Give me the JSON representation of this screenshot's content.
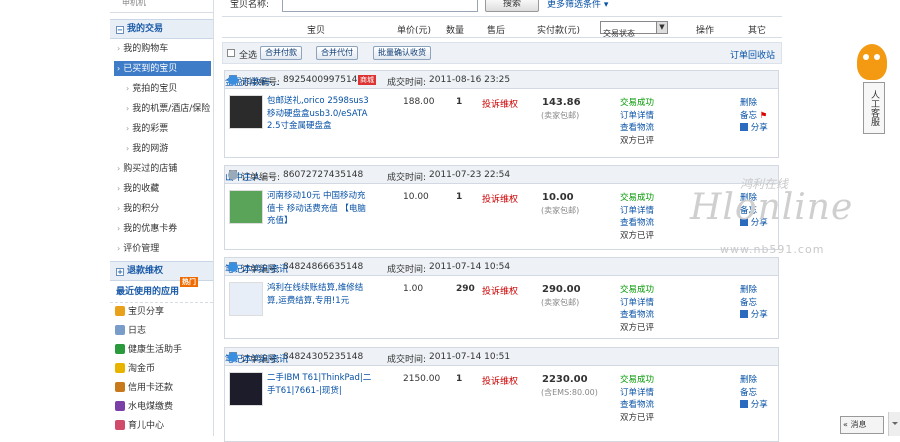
{
  "sidebar": {
    "top_label": "申机机",
    "trade_header": "我的交易",
    "items": [
      {
        "label": "我的购物车"
      },
      {
        "label": "已买到的宝贝",
        "active": true
      },
      {
        "label": "竞拍的宝贝",
        "sub": true
      },
      {
        "label": "我的机票/酒店/保险",
        "sub": true
      },
      {
        "label": "我的彩票",
        "sub": true
      },
      {
        "label": "我的网游",
        "sub": true
      },
      {
        "label": "购买过的店铺"
      },
      {
        "label": "我的收藏"
      },
      {
        "label": "我的积分"
      },
      {
        "label": "我的优惠卡券"
      },
      {
        "label": "评价管理"
      }
    ],
    "refund_header": "退款维权",
    "apps_header": "最近使用的应用",
    "apps_badge": "热门",
    "apps": [
      {
        "label": "宝贝分享",
        "color": "#e9a11b"
      },
      {
        "label": "日志",
        "color": "#7a9cc8"
      },
      {
        "label": "健康生活助手",
        "color": "#2a9a3c"
      },
      {
        "label": "淘金币",
        "color": "#e8b400"
      },
      {
        "label": "信用卡还款",
        "color": "#c8791b"
      },
      {
        "label": "水电煤缴费",
        "color": "#7b3fa8"
      },
      {
        "label": "育儿中心",
        "color": "#d04a6a"
      }
    ]
  },
  "search": {
    "label": "宝贝名称:",
    "button": "搜索",
    "more_filters": "更多筛选条件"
  },
  "table_header": {
    "item": "宝贝",
    "unit_price": "单价(元)",
    "quantity": "数量",
    "after_sale": "售后",
    "paid": "实付款(元)",
    "status_select": "交易状态",
    "actions": "操作",
    "other": "其它"
  },
  "batch": {
    "select_all": "全选",
    "merge_pay": "合并付款",
    "merge_proxy_pay": "合并代付",
    "batch_confirm": "批量确认收货",
    "recycle": "订单回收站"
  },
  "labels": {
    "order_no": "订单编号:",
    "deal_time": "成交时间:",
    "complain": "投诉维权",
    "order_detail": "订单详情",
    "view_logistics": "查看物流",
    "both_rated": "双方已评",
    "delete": "删除",
    "memo": "备忘",
    "share": "分享"
  },
  "orders": [
    {
      "order_no": "89254009975148",
      "badge": "商城",
      "deal_time": "2011-08-16 23:25",
      "shop": "金盈科数码...",
      "title": "包邮送礼,orico 2598sus3移动硬盘盒usb3.0/eSATA 2.5寸金属硬盘盒",
      "price": "188.00",
      "qty": "1",
      "paid": "143.86",
      "shipping": "(卖家包邮)",
      "status": "交易成功",
      "memo_flag": true,
      "thumb_color": "#2b2b2b"
    },
    {
      "order_no": "86072727435148",
      "deal_time": "2011-07-23 22:54",
      "shop": "山中主人",
      "title": "河南移动10元 中国移动充值卡 移动话费充值 【电脑充值】",
      "price": "10.00",
      "qty": "1",
      "paid": "10.00",
      "shipping": "(卖家包邮)",
      "status": "交易成功",
      "thumb_color": "#5aa45a"
    },
    {
      "order_no": "84824866635148",
      "deal_time": "2011-07-14 10:54",
      "shop": "笔记本鸿利资讯",
      "title": "鸿利在线续账结算,维修结算,运费结算,专用!1元",
      "price": "1.00",
      "qty": "290",
      "paid": "290.00",
      "shipping": "(卖家包邮)",
      "status": "交易成功",
      "thumb_color": "#e8eef8"
    },
    {
      "order_no": "84824305235148",
      "deal_time": "2011-07-14 10:51",
      "shop": "笔记本鸿利资讯",
      "title": "二手IBM T61|ThinkPad|二手T61|7661-|现货|",
      "price": "2150.00",
      "qty": "1",
      "paid": "2230.00",
      "shipping": "(含EMS:80.00)",
      "status": "交易成功",
      "thumb_color": "#1c1c2a"
    }
  ],
  "watermark": {
    "cn": "鸿利在线",
    "en": "Hlonline",
    "url": "www.nb591.com"
  },
  "service": {
    "label": "人工客服",
    "messages": "消息"
  }
}
